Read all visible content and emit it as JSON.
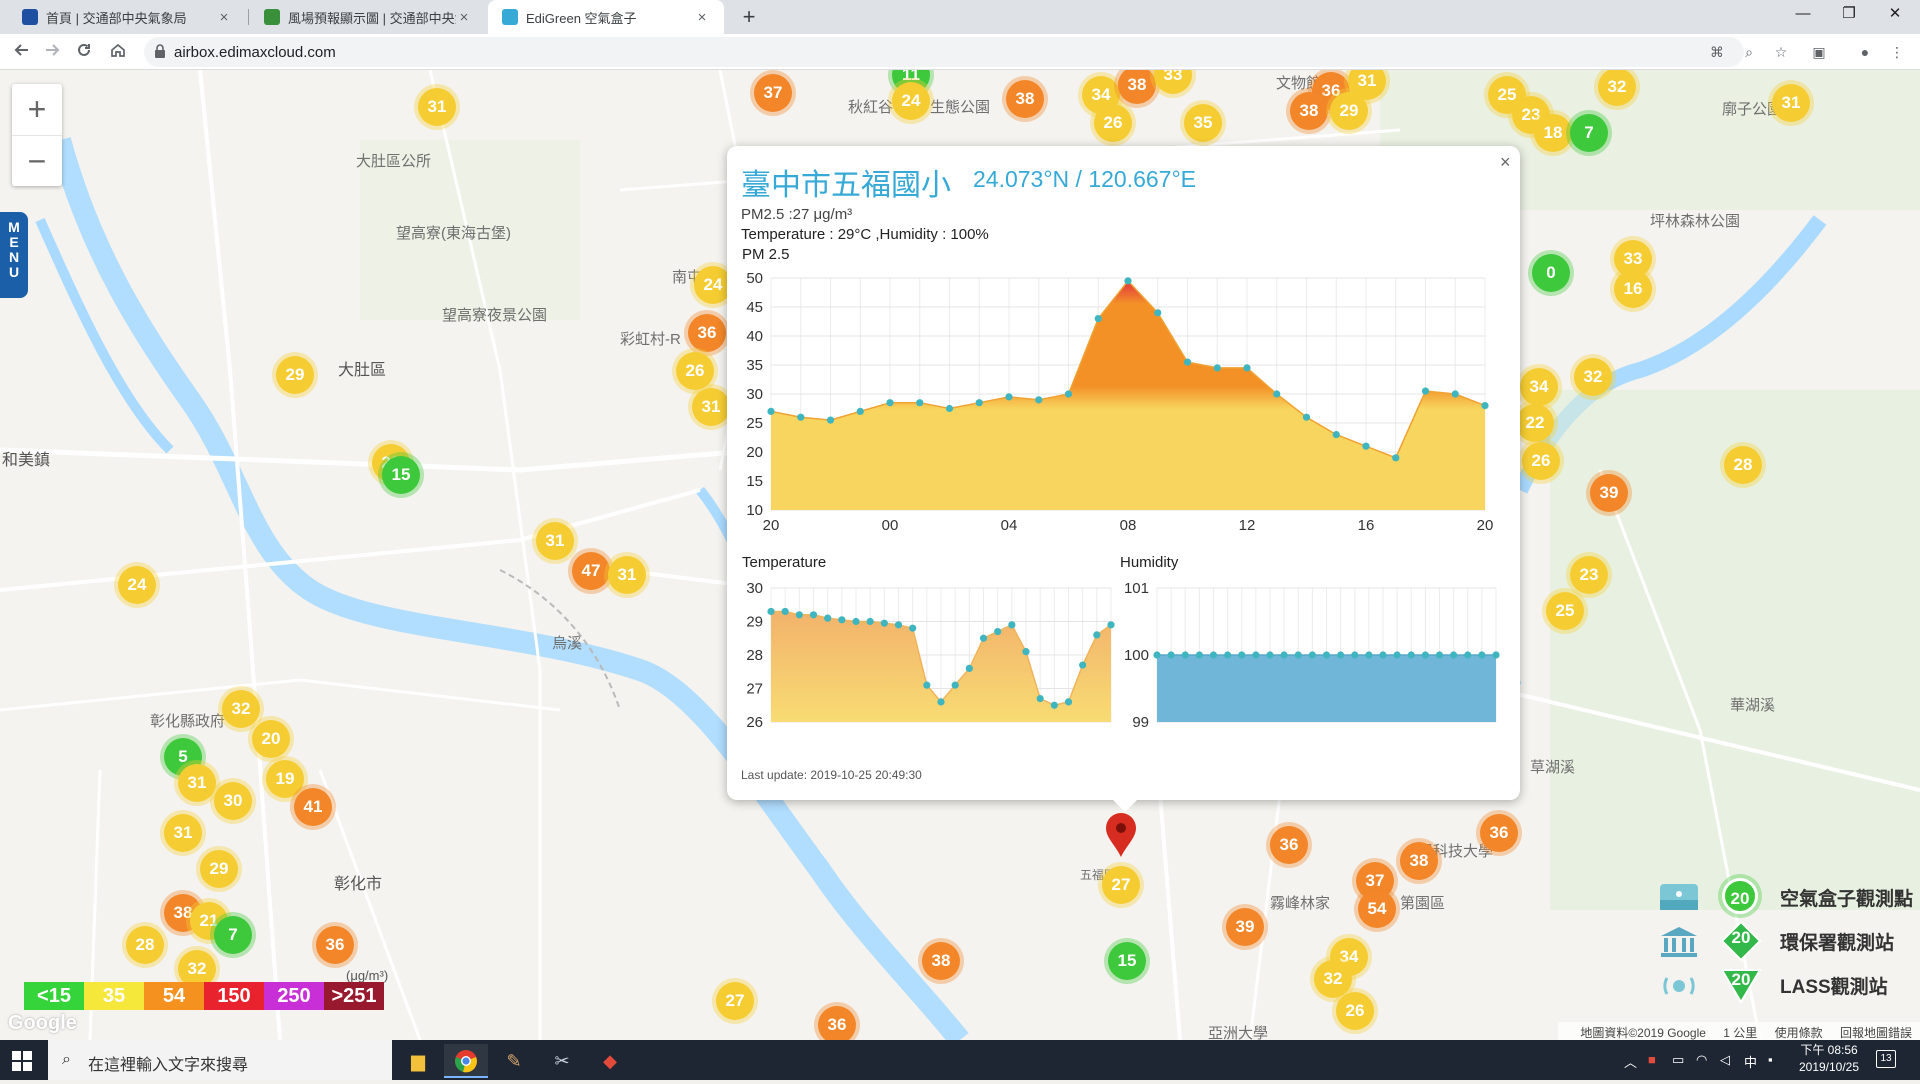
{
  "browser": {
    "tabs": [
      {
        "title": "首頁 | 交通部中央氣象局",
        "active": false
      },
      {
        "title": "風場預報顯示圖 | 交通部中央氣象局",
        "active": false
      },
      {
        "title": "EdiGreen 空氣盒子",
        "active": true
      }
    ],
    "new_tab_label": "+",
    "close_label": "×",
    "url": "airbox.edimaxcloud.com",
    "window": {
      "minimize": "—",
      "maximize": "❐",
      "close": "✕"
    }
  },
  "map": {
    "zoom_in": "+",
    "zoom_out": "−",
    "menu_letters": [
      "M",
      "E",
      "N",
      "U"
    ],
    "places": [
      "大肚區",
      "大肚區公所",
      "望高寮(東海古堡)",
      "望高寮夜景公園",
      "和美鎮",
      "彰化市",
      "彰化縣政府",
      "南屯",
      "彩虹村-R",
      "烏溪",
      "坪林森林公園",
      "文物館",
      "秋紅谷",
      "生態公園",
      "廓子公園",
      "霧峰林家",
      "亞洲大學",
      "陽科技大學",
      "草湖溪",
      "華湖溪",
      "五福國小",
      "第園區"
    ],
    "markers": [
      {
        "value": "31",
        "color": "yellow"
      },
      {
        "value": "29",
        "color": "yellow"
      },
      {
        "value": "22",
        "color": "yellow"
      },
      {
        "value": "15",
        "color": "green"
      },
      {
        "value": "24",
        "color": "yellow"
      },
      {
        "value": "31",
        "color": "yellow"
      },
      {
        "value": "47",
        "color": "orange"
      },
      {
        "value": "31",
        "color": "yellow"
      },
      {
        "value": "32",
        "color": "yellow"
      },
      {
        "value": "5",
        "color": "green"
      },
      {
        "value": "20",
        "color": "yellow"
      },
      {
        "value": "19",
        "color": "yellow"
      },
      {
        "value": "31",
        "color": "yellow"
      },
      {
        "value": "30",
        "color": "yellow"
      },
      {
        "value": "41",
        "color": "orange"
      },
      {
        "value": "31",
        "color": "yellow"
      },
      {
        "value": "29",
        "color": "yellow"
      },
      {
        "value": "38",
        "color": "orange"
      },
      {
        "value": "21",
        "color": "yellow"
      },
      {
        "value": "7",
        "color": "green"
      },
      {
        "value": "28",
        "color": "yellow"
      },
      {
        "value": "36",
        "color": "orange"
      },
      {
        "value": "32",
        "color": "yellow"
      },
      {
        "value": "37",
        "color": "orange"
      },
      {
        "value": "11",
        "color": "green"
      },
      {
        "value": "24",
        "color": "yellow"
      },
      {
        "value": "38",
        "color": "orange"
      },
      {
        "value": "34",
        "color": "yellow"
      },
      {
        "value": "38",
        "color": "orange"
      },
      {
        "value": "33",
        "color": "yellow"
      },
      {
        "value": "26",
        "color": "yellow"
      },
      {
        "value": "35",
        "color": "yellow"
      },
      {
        "value": "36",
        "color": "orange"
      },
      {
        "value": "31",
        "color": "yellow"
      },
      {
        "value": "38",
        "color": "orange"
      },
      {
        "value": "29",
        "color": "yellow"
      },
      {
        "value": "25",
        "color": "yellow"
      },
      {
        "value": "32",
        "color": "yellow"
      },
      {
        "value": "23",
        "color": "yellow"
      },
      {
        "value": "18",
        "color": "yellow"
      },
      {
        "value": "7",
        "color": "green"
      },
      {
        "value": "31",
        "color": "yellow"
      },
      {
        "value": "0",
        "color": "green"
      },
      {
        "value": "33",
        "color": "yellow"
      },
      {
        "value": "16",
        "color": "yellow"
      },
      {
        "value": "34",
        "color": "yellow"
      },
      {
        "value": "32",
        "color": "yellow"
      },
      {
        "value": "22",
        "color": "yellow"
      },
      {
        "value": "26",
        "color": "yellow"
      },
      {
        "value": "28",
        "color": "yellow"
      },
      {
        "value": "39",
        "color": "orange"
      },
      {
        "value": "23",
        "color": "yellow"
      },
      {
        "value": "25",
        "color": "yellow"
      },
      {
        "value": "36",
        "color": "orange"
      },
      {
        "value": "26",
        "color": "yellow"
      },
      {
        "value": "31",
        "color": "yellow"
      },
      {
        "value": "24",
        "color": "yellow"
      },
      {
        "value": "36",
        "color": "orange"
      },
      {
        "value": "37",
        "color": "orange"
      },
      {
        "value": "38",
        "color": "orange"
      },
      {
        "value": "54",
        "color": "orange"
      },
      {
        "value": "36",
        "color": "orange"
      },
      {
        "value": "39",
        "color": "orange"
      },
      {
        "value": "34",
        "color": "yellow"
      },
      {
        "value": "32",
        "color": "yellow"
      },
      {
        "value": "26",
        "color": "yellow"
      },
      {
        "value": "38",
        "color": "orange"
      },
      {
        "value": "15",
        "color": "green"
      },
      {
        "value": "27",
        "color": "yellow"
      },
      {
        "value": "36",
        "color": "orange"
      },
      {
        "value": "27",
        "color": "yellow"
      }
    ],
    "aqi_scale": [
      {
        "label": "<15",
        "color": "#35d43a"
      },
      {
        "label": "35",
        "color": "#f6e83a"
      },
      {
        "label": "54",
        "color": "#f5921f"
      },
      {
        "label": "150",
        "color": "#e8232d"
      },
      {
        "label": "250",
        "color": "#c82fd6"
      },
      {
        "label": ">251",
        "color": "#98182d"
      }
    ],
    "aqi_unit": "(μg/m³)",
    "google_logo": "Google",
    "station_legend": {
      "sample_value": "20",
      "items": [
        "空氣盒子觀測點",
        "環保署觀測站",
        "LASS觀測站"
      ]
    },
    "footer": [
      "地圖資料©2019 Google",
      "1 公里",
      "使用條款",
      "回報地圖錯誤"
    ]
  },
  "popup": {
    "close": "×",
    "title": "臺中市五福國小",
    "coords": "24.073°N / 120.667°E",
    "pm25_line": "PM2.5 :27 μg/m³",
    "temp_humidity_line": "Temperature : 29°C ,Humidity : 100%",
    "last_update": "Last update: 2019-10-25 20:49:30"
  },
  "chart_data": [
    {
      "type": "area",
      "title": "PM 2.5",
      "xlabel": "",
      "ylabel": "",
      "x_tick_labels": [
        "20",
        "00",
        "04",
        "08",
        "12",
        "16",
        "20"
      ],
      "ylim": [
        10,
        50
      ],
      "y_ticks": [
        10,
        15,
        20,
        25,
        30,
        35,
        40,
        45,
        50
      ],
      "grid": true,
      "x_hours": [
        0,
        1,
        2,
        3,
        4,
        5,
        6,
        7,
        8,
        9,
        10,
        11,
        12,
        13,
        14,
        15,
        16,
        17,
        18,
        19,
        20,
        21,
        22,
        23,
        24
      ],
      "values": [
        27,
        26,
        25.5,
        27,
        28.5,
        28.5,
        27.5,
        28.5,
        29.5,
        29,
        30,
        43,
        49.5,
        44,
        35.5,
        34.5,
        34.5,
        30,
        26,
        23,
        21,
        19,
        30.5,
        30,
        28
      ],
      "colors": {
        "fill_low": "#f7d55e",
        "fill_high": "#f39127",
        "peak": "#e33440",
        "point": "#3fb5bf"
      }
    },
    {
      "type": "area",
      "title": "Temperature",
      "xlabel": "",
      "ylabel": "",
      "ylim": [
        26,
        30
      ],
      "y_ticks": [
        26,
        27,
        28,
        29,
        30
      ],
      "grid": true,
      "x_hours": [
        0,
        1,
        2,
        3,
        4,
        5,
        6,
        7,
        8,
        9,
        10,
        11,
        12,
        13,
        14,
        15,
        16,
        17,
        18,
        19,
        20,
        21,
        22,
        23,
        24
      ],
      "values": [
        29.3,
        29.3,
        29.2,
        29.2,
        29.1,
        29.05,
        29,
        29,
        28.95,
        28.9,
        28.8,
        27.1,
        26.6,
        27.1,
        27.6,
        28.5,
        28.7,
        28.9,
        28.1,
        26.7,
        26.5,
        26.6,
        27.7,
        28.6,
        28.9
      ],
      "colors": {
        "fill": "#f4c77e",
        "point": "#3fb5bf"
      }
    },
    {
      "type": "area",
      "title": "Humidity",
      "xlabel": "",
      "ylabel": "",
      "ylim": [
        99,
        101
      ],
      "y_ticks": [
        99,
        100,
        101
      ],
      "grid": true,
      "x_hours": [
        0,
        1,
        2,
        3,
        4,
        5,
        6,
        7,
        8,
        9,
        10,
        11,
        12,
        13,
        14,
        15,
        16,
        17,
        18,
        19,
        20,
        21,
        22,
        23,
        24
      ],
      "values": [
        100,
        100,
        100,
        100,
        100,
        100,
        100,
        100,
        100,
        100,
        100,
        100,
        100,
        100,
        100,
        100,
        100,
        100,
        100,
        100,
        100,
        100,
        100,
        100,
        100
      ],
      "colors": {
        "fill": "#6fb6d8",
        "point": "#3fb5bf"
      }
    }
  ],
  "taskbar": {
    "search_placeholder": "在這裡輸入文字來搜尋",
    "ime": "中",
    "time": "下午 08:56",
    "date": "2019/10/25",
    "notifications": "13"
  }
}
